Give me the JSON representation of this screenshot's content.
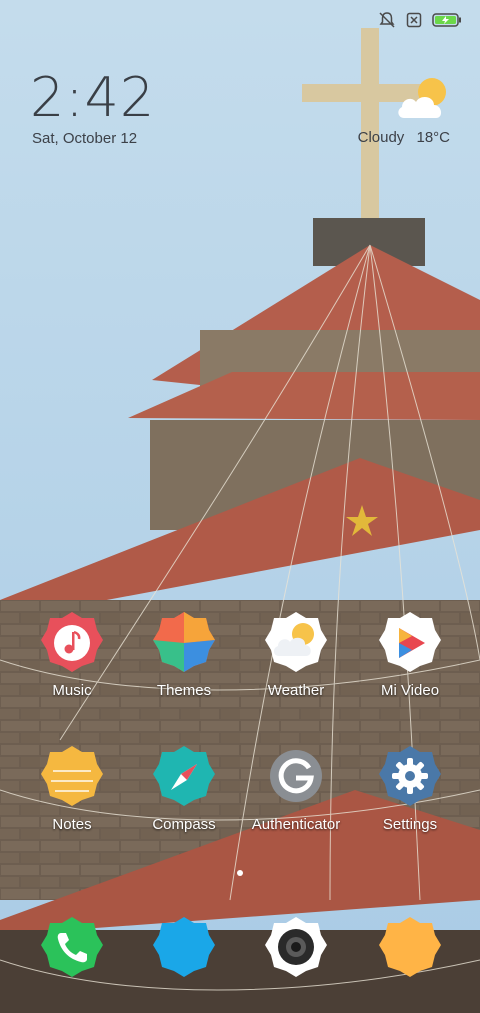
{
  "status_bar": {
    "icons": [
      "bell-off-icon",
      "sim-off-icon",
      "battery-charging-icon"
    ],
    "colors": {
      "battery": "#6bd84a"
    }
  },
  "clock": {
    "time": "2:42",
    "date": "Sat, October 12"
  },
  "weather": {
    "condition": "Cloudy",
    "temperature": "18°C",
    "icon": "partly-cloudy-icon"
  },
  "apps": [
    {
      "label": "Music",
      "icon": "music-note-icon",
      "color": "#e8505b"
    },
    {
      "label": "Themes",
      "icon": "themes-icon",
      "color": "#f26a4b"
    },
    {
      "label": "Weather",
      "icon": "weather-icon",
      "color": "#ffffff"
    },
    {
      "label": "Mi Video",
      "icon": "play-icon",
      "color": "#ffffff"
    },
    {
      "label": "Notes",
      "icon": "notes-icon",
      "color": "#f5b840"
    },
    {
      "label": "Compass",
      "icon": "compass-icon",
      "color": "#1fb6b1"
    },
    {
      "label": "Authenticator",
      "icon": "authenticator-icon",
      "color": "#8a8e93"
    },
    {
      "label": "Settings",
      "icon": "settings-gear-icon",
      "color": "#4a78a8"
    }
  ],
  "dock": [
    {
      "icon": "phone-icon",
      "color": "#2bc25a"
    },
    {
      "icon": "messages-icon",
      "color": "#1aa7e8"
    },
    {
      "icon": "camera-icon",
      "color": "#ffffff"
    },
    {
      "icon": "browser-icon",
      "color": "#ffb446"
    }
  ],
  "page_indicator": {
    "pages": 1,
    "active": 0
  }
}
